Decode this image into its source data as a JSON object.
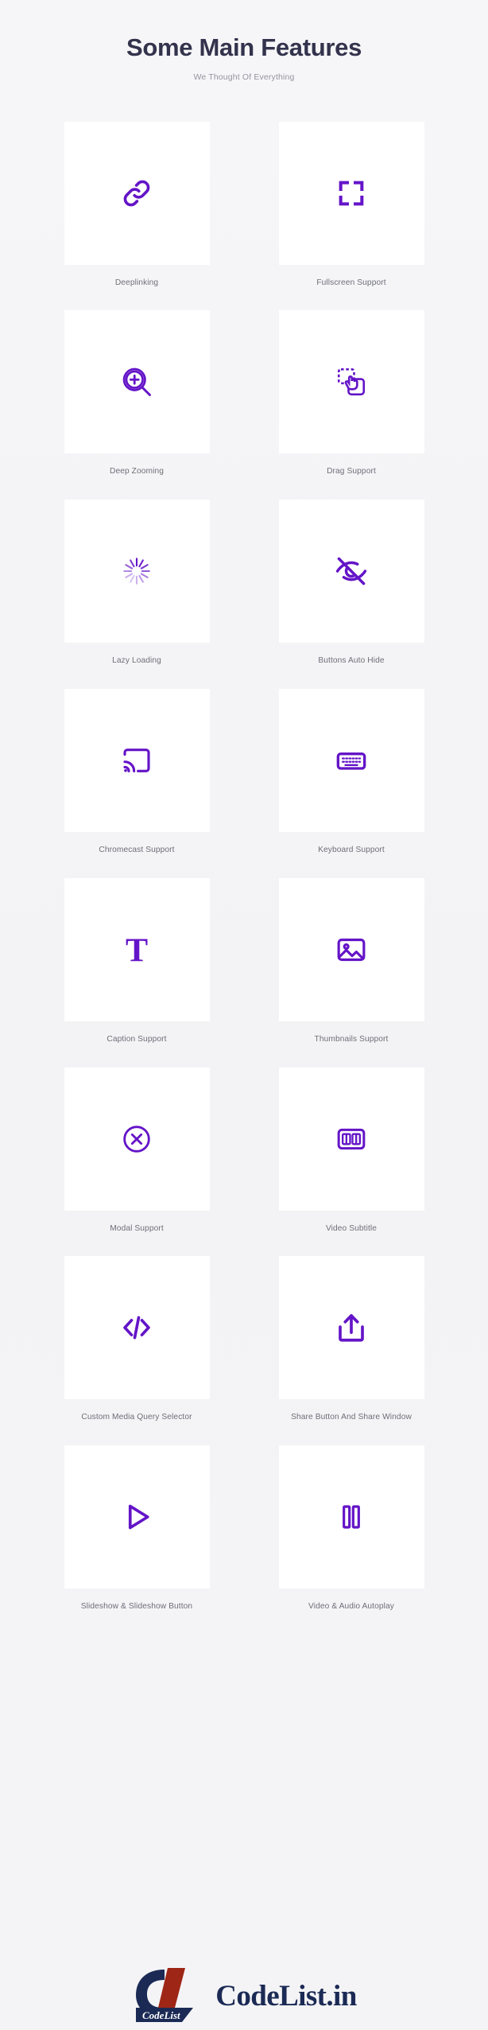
{
  "header": {
    "title": "Some Main Features",
    "subtitle": "We Thought Of Everything"
  },
  "theme": {
    "background": "#f4f4f6",
    "card_background": "#ffffff",
    "icon_color": "#6414c8",
    "title_color": "#33334d",
    "subtitle_color": "#9494a0",
    "label_color": "#6e6e7a"
  },
  "features": [
    {
      "icon": "link-icon",
      "label": "Deeplinking"
    },
    {
      "icon": "fullscreen-icon",
      "label": "Fullscreen Support"
    },
    {
      "icon": "zoom-in-icon",
      "label": "Deep Zooming"
    },
    {
      "icon": "drag-hand-icon",
      "label": "Drag Support"
    },
    {
      "icon": "spinner-icon",
      "label": "Lazy Loading"
    },
    {
      "icon": "eye-off-icon",
      "label": "Buttons Auto Hide"
    },
    {
      "icon": "cast-icon",
      "label": "Chromecast Support"
    },
    {
      "icon": "keyboard-icon",
      "label": "Keyboard Support"
    },
    {
      "icon": "text-caption-icon",
      "label": "Caption Support"
    },
    {
      "icon": "image-thumbnail-icon",
      "label": "Thumbnails Support"
    },
    {
      "icon": "close-circle-icon",
      "label": "Modal Support"
    },
    {
      "icon": "closed-caption-icon",
      "label": "Video Subtitle"
    },
    {
      "icon": "code-brackets-icon",
      "label": "Custom Media Query Selector"
    },
    {
      "icon": "share-icon",
      "label": "Share Button And Share Window"
    },
    {
      "icon": "play-icon",
      "label": "Slideshow & Slideshow Button"
    },
    {
      "icon": "pause-icon",
      "label": "Video & Audio Autoplay"
    }
  ],
  "footer": {
    "logo_mark_text": "CodeList",
    "logo_text": "CodeList.in"
  }
}
